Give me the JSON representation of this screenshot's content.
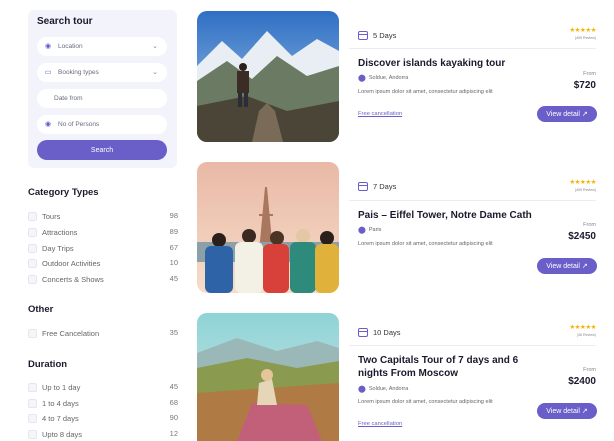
{
  "search": {
    "title": "Search tour",
    "location": "Location",
    "booking_types": "Booking types",
    "date_from": "Date from",
    "persons": "No of Persons",
    "button": "Search"
  },
  "category": {
    "title": "Category Types",
    "items": [
      {
        "label": "Tours",
        "count": "98"
      },
      {
        "label": "Attractions",
        "count": "89"
      },
      {
        "label": "Day Trips",
        "count": "67"
      },
      {
        "label": "Outdoor Activities",
        "count": "10"
      },
      {
        "label": "Concerts & Shows",
        "count": "45"
      }
    ]
  },
  "other": {
    "title": "Other",
    "items": [
      {
        "label": "Free Cancelation",
        "count": "35"
      }
    ]
  },
  "duration": {
    "title": "Duration",
    "items": [
      {
        "label": "Up to 1 day",
        "count": "45"
      },
      {
        "label": "1 to 4 days",
        "count": "68"
      },
      {
        "label": "4 to 7 days",
        "count": "90"
      },
      {
        "label": "Upto 8 days",
        "count": "12"
      }
    ]
  },
  "tours": [
    {
      "days": "5 Days",
      "stars": "★★★★★",
      "reviews": "(459 Review)",
      "title": "Discover islands kayaking tour",
      "location": "Soldue, Andorra",
      "description": "Lorem ipsum dolor sit amet, consectetur adipiscing elit",
      "free_cancel": "Free cancellation",
      "from": "From",
      "price": "$720",
      "button": "View detail ↗"
    },
    {
      "days": "7 Days",
      "stars": "★★★★★",
      "reviews": "(459 Review)",
      "title": "Pais – Eiffel Tower, Notre Dame Cath",
      "location": "Paris",
      "description": "Lorem ipsum dolor sit amet, consectetur adipiscing elit",
      "from": "From",
      "price": "$2450",
      "button": "View detail ↗"
    },
    {
      "days": "10 Days",
      "stars": "★★★★★",
      "reviews": "(36 Review)",
      "title": "Two Capitals Tour of 7 days and 6 nights From Moscow",
      "location": "Soldue, Andorra",
      "description": "Lorem ipsum dolor sit amet, consectetur adipiscing elit",
      "free_cancel": "Free cancellation",
      "from": "From",
      "price": "$2400",
      "button": "View detail ↗"
    }
  ],
  "colors": {
    "accent": "#6a5ec8",
    "star": "#f5b301",
    "panel": "#f3f3fb"
  }
}
